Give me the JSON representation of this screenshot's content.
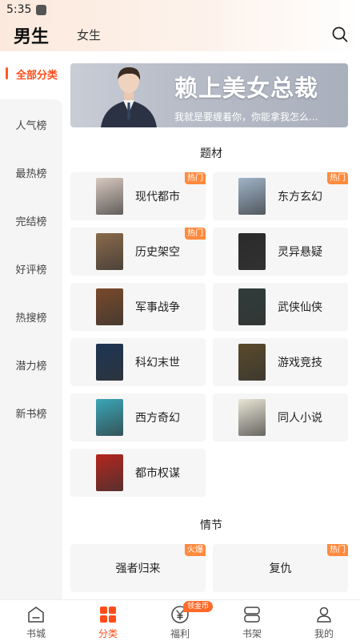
{
  "status_bar": {
    "time": "5:35"
  },
  "header": {
    "tab_male": "男生",
    "tab_female": "女生"
  },
  "sidebar": {
    "active": "全部分类",
    "items": [
      "人气榜",
      "最热榜",
      "完结榜",
      "好评榜",
      "热搜榜",
      "潜力榜",
      "新书榜"
    ]
  },
  "banner": {
    "title": "赖上美女总裁",
    "subtitle": "我就是要缠着你，你能拿我怎么..."
  },
  "sections": {
    "genre_title": "题材",
    "plot_title": "情节"
  },
  "genres": [
    {
      "name": "现代都市",
      "badge": "热门",
      "cover": "#d8c9c0"
    },
    {
      "name": "东方玄幻",
      "badge": "热门",
      "cover": "#9fb4c8"
    },
    {
      "name": "历史架空",
      "badge": "热门",
      "cover": "#8a6a4a"
    },
    {
      "name": "灵异悬疑",
      "badge": "",
      "cover": "#2b2b2b"
    },
    {
      "name": "军事战争",
      "badge": "",
      "cover": "#7a4a2a"
    },
    {
      "name": "武侠仙侠",
      "badge": "",
      "cover": "#2f3d3a"
    },
    {
      "name": "科幻末世",
      "badge": "",
      "cover": "#1d3555"
    },
    {
      "name": "游戏竞技",
      "badge": "",
      "cover": "#5a4a2a"
    },
    {
      "name": "西方奇幻",
      "badge": "",
      "cover": "#3aa6b8"
    },
    {
      "name": "同人小说",
      "badge": "",
      "cover": "#e9e6d6"
    },
    {
      "name": "都市权谋",
      "badge": "",
      "cover": "#b5261e"
    }
  ],
  "plots": [
    {
      "name": "强者归来",
      "badge": "火爆"
    },
    {
      "name": "复仇",
      "badge": "热门"
    }
  ],
  "bottom_nav": {
    "items": [
      "书城",
      "分类",
      "福利",
      "书架",
      "我的"
    ],
    "active_index": 1,
    "gold_badge": "领金币"
  },
  "colors": {
    "accent": "#ff4d1a",
    "badge": "#ff8a3d"
  }
}
